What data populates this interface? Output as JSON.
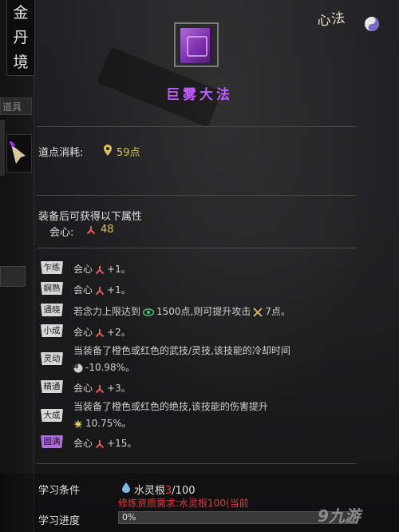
{
  "realm": [
    "金",
    "丹",
    "境"
  ],
  "left_tags": [
    "道具"
  ],
  "corner": {
    "title": "心法"
  },
  "skill": {
    "name": "巨雾大法"
  },
  "cost": {
    "label": "道点消耗:",
    "value": "59点"
  },
  "equip": {
    "header": "装备后可获得以下属性",
    "stat_label": "会心:",
    "stat_value": "48"
  },
  "tiers": [
    {
      "tag": "乍练",
      "text": "会心",
      "value": "+1。"
    },
    {
      "tag": "娴熟",
      "text": "会心",
      "value": "+1。"
    },
    {
      "tag": "通晓",
      "text_a": "若念力上限达到",
      "num": "1500点,则可提升攻击",
      "value": "7点。"
    },
    {
      "tag": "小成",
      "text": "会心",
      "value": "+2。"
    },
    {
      "tag": "灵动",
      "line1": "当装备了橙色或红色的武技/灵技,该技能的冷却时间",
      "line2": "-10.98%。"
    },
    {
      "tag": "精通",
      "text": "会心",
      "value": "+3。"
    },
    {
      "tag": "大成",
      "line1": "当装备了橙色或红色的绝技,该技能的伤害提升",
      "line2": "10.75%。"
    },
    {
      "tag": "圆满",
      "text": "会心",
      "value": "+15。"
    }
  ],
  "learn": {
    "cond_label": "学习条件",
    "root_name": "水灵根",
    "root_have": "3",
    "root_need": "/100",
    "warning": "修炼资质需求:水灵根100(当前",
    "progress_label": "学习进度",
    "progress_text": "0%",
    "progress": 0
  },
  "watermark": "9九游",
  "colors": {
    "accent": "#c25aff",
    "gold": "#d9c25a",
    "warning": "#e13b3b"
  }
}
